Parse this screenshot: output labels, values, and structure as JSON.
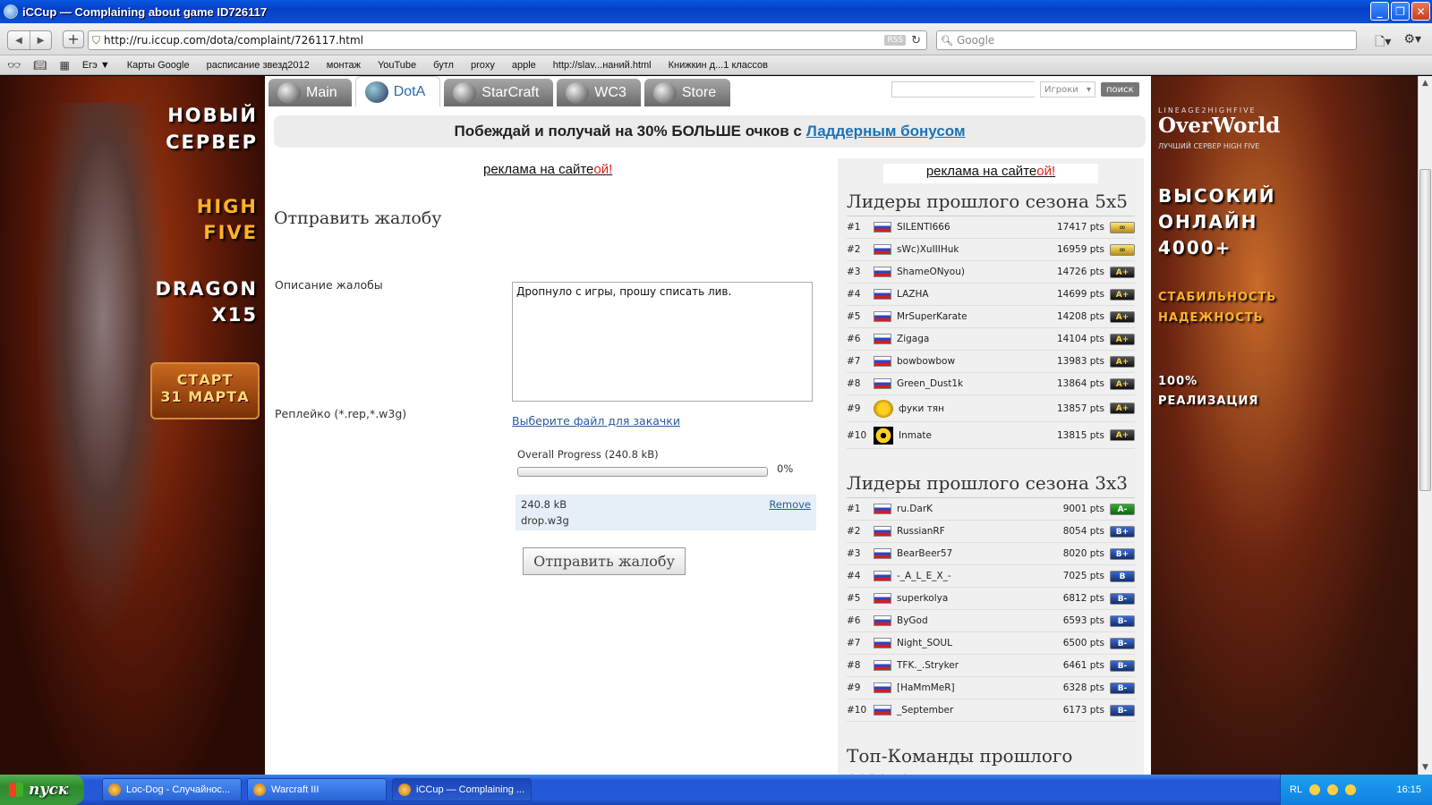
{
  "window": {
    "title": "iCCup — Complaining about game ID726117",
    "minimize": "_",
    "maximize": "❐",
    "close": "✕"
  },
  "browser": {
    "url": "http://ru.iccup.com/dota/complaint/726117.html",
    "rss": "RSS",
    "search_placeholder": "Google",
    "bookmarks": [
      "Егэ ▼",
      "Карты Google",
      "расписание звезд2012",
      "монтаж",
      "YouTube",
      "бутл",
      "proxy",
      "apple",
      "http://slav...наний.html",
      "Книжкин д...1 классов"
    ]
  },
  "left_ad": {
    "line1": "НОВЫЙ",
    "line2": "СЕРВЕР",
    "line3": "HIGH",
    "line4": "FIVE",
    "line5": "DRAGON",
    "line6": "X15",
    "start_line1": "СТАРТ",
    "start_line2": "31 МАРТА"
  },
  "right_ad": {
    "small": "LINEAGE2HIGHFIVE",
    "logo": "OverWorld",
    "sub": "ЛУЧШИЙ СЕРВЕР HIGH FIVE",
    "line1": "ВЫСОКИЙ",
    "line2": "ОНЛАЙН",
    "line3": "4000+",
    "line4": "СТАБИЛЬНОСТЬ",
    "line5": "НАДЕЖНОСТЬ",
    "line6": "100%",
    "line7": "РЕАЛИЗАЦИЯ"
  },
  "tabs": [
    {
      "label": "Main",
      "active": false
    },
    {
      "label": "DotA",
      "active": true
    },
    {
      "label": "StarCraft",
      "active": false
    },
    {
      "label": "WC3",
      "active": false
    },
    {
      "label": "Store",
      "active": false
    }
  ],
  "top_search": {
    "select": "Игроки",
    "button": "поиск"
  },
  "banner": {
    "text": "Побеждай и получай на 30% БОЛЬШЕ очков с",
    "link": "Ладдерным бонусом"
  },
  "ad_text": {
    "main": "реклама на сайте",
    "red": "ой!"
  },
  "form": {
    "title": "Отправить жалобу",
    "description_label": "Описание жалобы",
    "description_value": "Дропнуло с игры, прошу списать лив.",
    "replay_label": "Реплейко (*.rep,*.w3g)",
    "file_link": "Выберите файл для закачки",
    "progress_label": "Overall Progress (240.8 kB)",
    "progress_value": 0,
    "progress_text": "0%",
    "file_size": "240.8 kB",
    "file_name": "drop.w3g",
    "remove": "Remove",
    "submit": "Отправить жалобу"
  },
  "leaders_5x5": {
    "title": "Лидеры прошлого сезона 5x5",
    "rows": [
      {
        "rank": "#1",
        "name": "SILENTI666",
        "pts": "17417 pts",
        "badge": "∞"
      },
      {
        "rank": "#2",
        "name": "sWc)XuIIIHuk",
        "pts": "16959 pts",
        "badge": "∞"
      },
      {
        "rank": "#3",
        "name": "ShameONyou)",
        "pts": "14726 pts",
        "badge": "A+"
      },
      {
        "rank": "#4",
        "name": "LAZHA",
        "pts": "14699 pts",
        "badge": "A+"
      },
      {
        "rank": "#5",
        "name": "MrSuperKarate",
        "pts": "14208 pts",
        "badge": "A+"
      },
      {
        "rank": "#6",
        "name": "Zigaga",
        "pts": "14104 pts",
        "badge": "A+"
      },
      {
        "rank": "#7",
        "name": "bowbowbow",
        "pts": "13983 pts",
        "badge": "A+"
      },
      {
        "rank": "#8",
        "name": "Green_Dust1k",
        "pts": "13864 pts",
        "badge": "A+"
      },
      {
        "rank": "#9",
        "name": "фуки тян",
        "pts": "13857 pts",
        "badge": "A+"
      },
      {
        "rank": "#10",
        "name": "Inmate",
        "pts": "13815 pts",
        "badge": "A+"
      }
    ]
  },
  "leaders_3x3": {
    "title": "Лидеры прошлого сезона 3x3",
    "rows": [
      {
        "rank": "#1",
        "name": "ru.DarK",
        "pts": "9001 pts",
        "badge": "A-"
      },
      {
        "rank": "#2",
        "name": "RussianRF",
        "pts": "8054 pts",
        "badge": "B+"
      },
      {
        "rank": "#3",
        "name": "BearBeer57",
        "pts": "8020 pts",
        "badge": "B+"
      },
      {
        "rank": "#4",
        "name": "-_A_L_E_X_-",
        "pts": "7025 pts",
        "badge": "B"
      },
      {
        "rank": "#5",
        "name": "superkolya",
        "pts": "6812 pts",
        "badge": "B-"
      },
      {
        "rank": "#6",
        "name": "ByGod",
        "pts": "6593 pts",
        "badge": "B-"
      },
      {
        "rank": "#7",
        "name": "Night_SOUL",
        "pts": "6500 pts",
        "badge": "B-"
      },
      {
        "rank": "#8",
        "name": "TFK._.Stryker",
        "pts": "6461 pts",
        "badge": "B-"
      },
      {
        "rank": "#9",
        "name": "[HaMmMeR]",
        "pts": "6328 pts",
        "badge": "B-"
      },
      {
        "rank": "#10",
        "name": "_September",
        "pts": "6173 pts",
        "badge": "B-"
      }
    ]
  },
  "teams_title": "Топ-Команды прошлого сезона",
  "taskbar": {
    "start": "пуск",
    "tasks": [
      "Loc-Dog - Случайнос...",
      "Warcraft III",
      "iCCup — Complaining ..."
    ],
    "lang": "RL",
    "clock": "16:15"
  }
}
